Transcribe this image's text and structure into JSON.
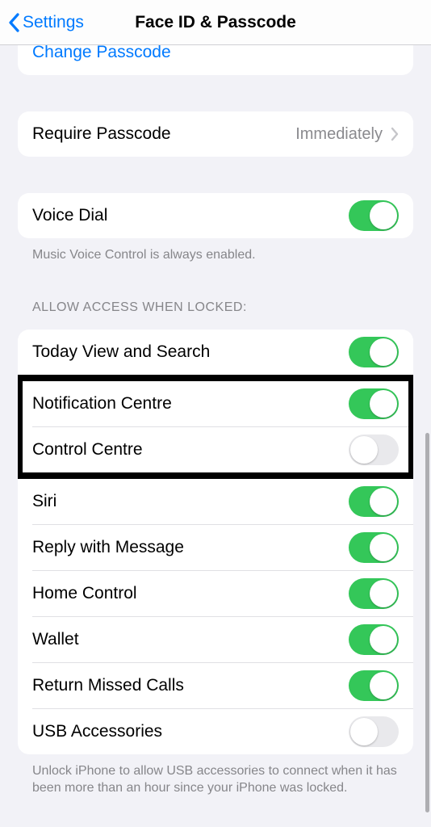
{
  "nav": {
    "back": "Settings",
    "title": "Face ID & Passcode"
  },
  "group1": {
    "change": "Change Passcode"
  },
  "require": {
    "label": "Require Passcode",
    "value": "Immediately"
  },
  "voiceDial": {
    "label": "Voice Dial",
    "footer": "Music Voice Control is always enabled."
  },
  "allow": {
    "header": "ALLOW ACCESS WHEN LOCKED:",
    "today": "Today View and Search",
    "notif": "Notification Centre",
    "control": "Control Centre",
    "siri": "Siri",
    "reply": "Reply with Message",
    "home": "Home Control",
    "wallet": "Wallet",
    "missed": "Return Missed Calls",
    "usb": "USB Accessories",
    "footer": "Unlock iPhone to allow USB accessories to connect when it has been more than an hour since your iPhone was locked."
  }
}
